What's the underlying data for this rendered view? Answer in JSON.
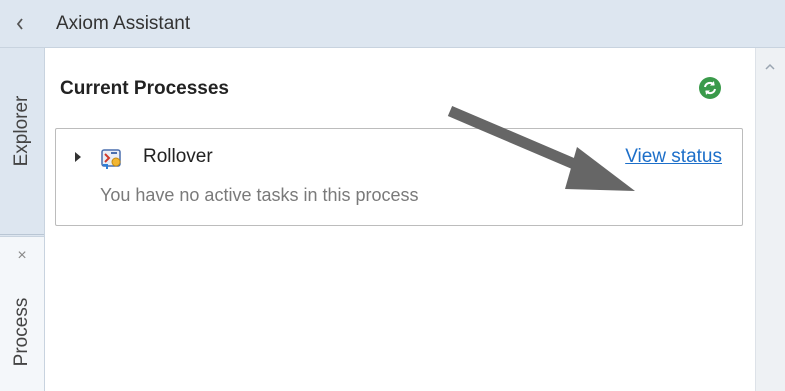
{
  "header": {
    "title": "Axiom Assistant",
    "collapse_icon": "chevron-left-icon"
  },
  "tabs": {
    "explorer_label": "Explorer",
    "process_label": "Process",
    "process_close_glyph": "×"
  },
  "main": {
    "section_title": "Current Processes",
    "refresh_icon": "refresh-icon",
    "process": {
      "name": "Rollover",
      "description": "You have no active tasks in this process",
      "link_label": "View status"
    }
  },
  "colors": {
    "header_bg": "#dde6f0",
    "link": "#1d6fc9",
    "refresh_green": "#3a9a4a",
    "arrow": "#666666"
  }
}
